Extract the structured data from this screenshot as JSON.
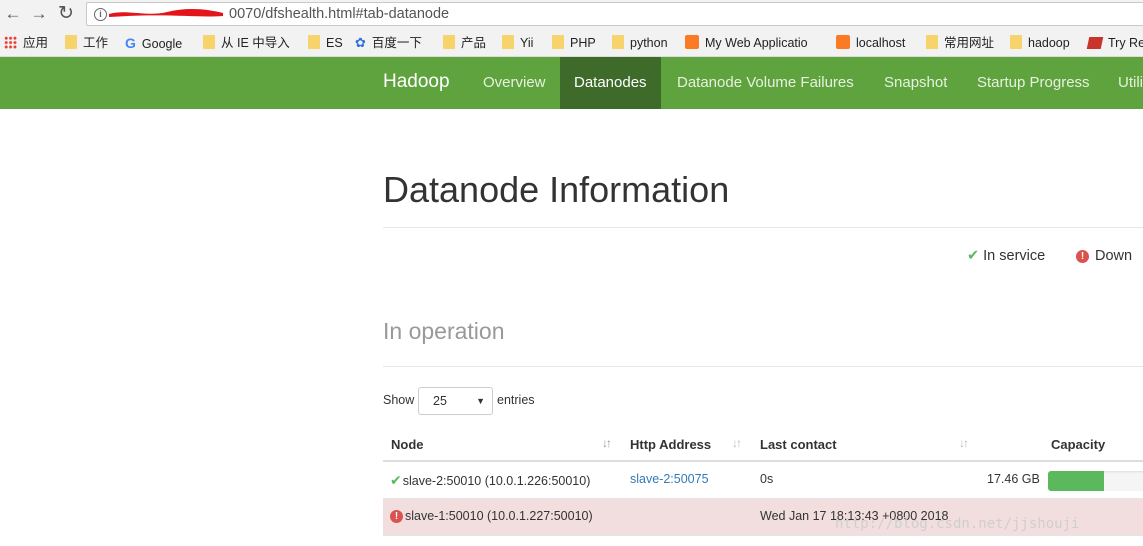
{
  "browser": {
    "url": "0070/dfshealth.html#tab-datanode",
    "bookmarks": [
      "应用",
      "工作",
      "Google",
      "从 IE 中导入",
      "ES",
      "百度一下",
      "产品",
      "Yii",
      "PHP",
      "python",
      "My Web Applicatio",
      "localhost",
      "常用网址",
      "hadoop",
      "Try Re"
    ]
  },
  "navbar": {
    "brand": "Hadoop",
    "links": [
      "Overview",
      "Datanodes",
      "Datanode Volume Failures",
      "Snapshot",
      "Startup Progress",
      "Utili"
    ],
    "active": "Datanodes",
    "color": "#5fa33e",
    "active_color": "#3e6b29"
  },
  "page": {
    "title": "Datanode Information",
    "legend_in_service": "In service",
    "legend_down": "Down",
    "section": "In operation",
    "show_label": "Show",
    "page_size": "25",
    "entries_label": "entries"
  },
  "table": {
    "columns": [
      "Node",
      "Http Address",
      "Last contact",
      "Capacity"
    ],
    "rows": [
      {
        "status": "in-service",
        "node": "slave-2:50010 (10.0.1.226:50010)",
        "http": "slave-2:50075",
        "last_contact": "0s",
        "capacity": "17.46 GB",
        "used_fraction": 0.56
      },
      {
        "status": "down",
        "node": "slave-1:50010 (10.0.1.227:50010)",
        "http": "",
        "last_contact": "Wed Jan 17 18:13:43 +0800 2018",
        "capacity": "",
        "used_fraction": null
      }
    ]
  },
  "watermark": "http://blog.csdn.net/jjshouji"
}
